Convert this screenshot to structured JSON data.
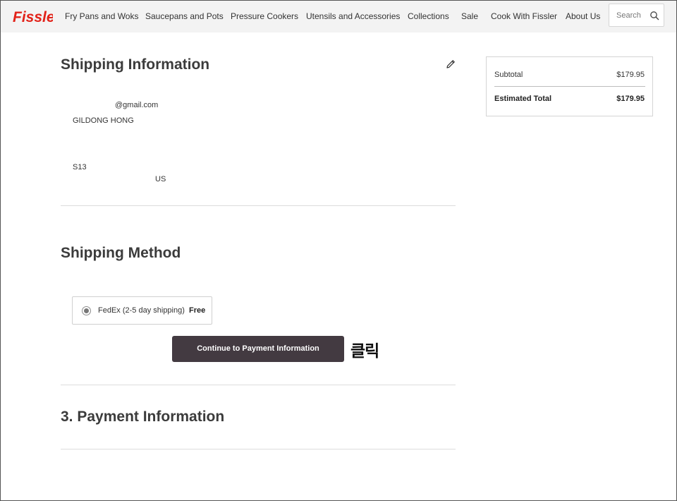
{
  "header": {
    "logo_text": "Fissler",
    "brand_color": "#e2231a",
    "nav": [
      "Fry Pans and Woks",
      "Saucepans and Pots",
      "Pressure Cookers",
      "Utensils and Accessories",
      "Collections",
      "Sale",
      "Cook With Fissler",
      "About Us"
    ],
    "search_placeholder": "Search"
  },
  "shipping_information": {
    "title": "Shipping Information",
    "email": "@gmail.com",
    "name": "GILDONG HONG",
    "address_line": "S13",
    "country": "US"
  },
  "shipping_method": {
    "title": "Shipping Method",
    "option_label": "FedEx (2-5 day shipping)",
    "option_price": "Free",
    "continue_label": "Continue to Payment Information",
    "annotation": "클릭"
  },
  "payment_information": {
    "title": "3. Payment Information"
  },
  "summary": {
    "subtotal_label": "Subtotal",
    "subtotal_value": "$179.95",
    "total_label": "Estimated Total",
    "total_value": "$179.95"
  },
  "colors": {
    "button": "#433a41",
    "heading": "#3b3b3b",
    "header_bg": "#f3f3f3"
  }
}
